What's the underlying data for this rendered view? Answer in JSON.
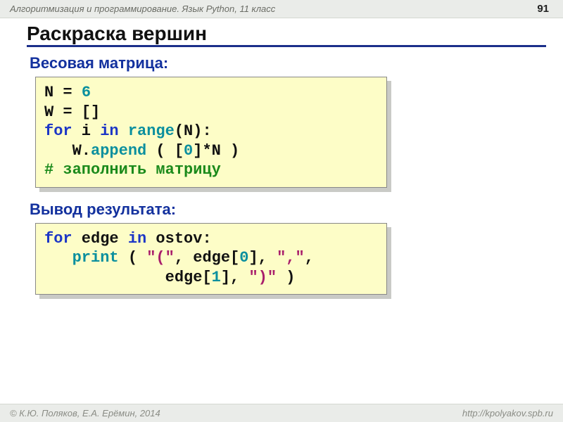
{
  "header": {
    "breadcrumb": "Алгоритмизация и программирование. Язык Python, 11 класс",
    "page_number": "91"
  },
  "title": "Раскраска вершин",
  "sections": {
    "weight_matrix_label": "Весовая матрица:",
    "output_label": "Вывод результата:"
  },
  "code1": {
    "l1a": "N = ",
    "l1b": "6",
    "l2": "W = []",
    "l3a": "for",
    "l3b": " i ",
    "l3c": "in",
    "l3d": " ",
    "l3e": "range",
    "l3f": "(N):",
    "l4a": "   W.",
    "l4b": "append",
    "l4c": " ( [",
    "l4d": "0",
    "l4e": "]*N )",
    "l5": "# заполнить матрицу"
  },
  "code2": {
    "l1a": "for",
    "l1b": " edge ",
    "l1c": "in",
    "l1d": " ostov:",
    "l2a": "   ",
    "l2b": "print",
    "l2c": " ( ",
    "l2d": "\"(\"",
    "l2e": ", edge[",
    "l2f": "0",
    "l2g": "], ",
    "l2h": "\",\"",
    "l2i": ",",
    "l3a": "             edge[",
    "l3b": "1",
    "l3c": "], ",
    "l3d": "\")\"",
    "l3e": " )"
  },
  "footer": {
    "left": "© К.Ю. Поляков, Е.А. Ерёмин, 2014",
    "right": "http://kpolyakov.spb.ru"
  }
}
